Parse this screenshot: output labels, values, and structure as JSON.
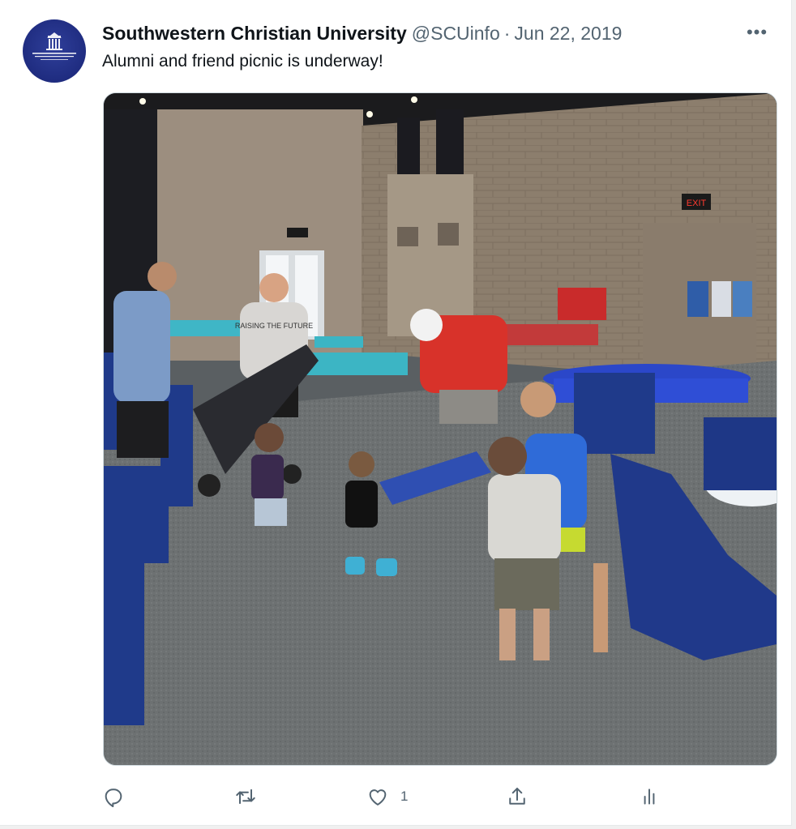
{
  "tweet": {
    "author_name": "Southwestern Christian University",
    "handle": "@SCUinfo",
    "separator": "·",
    "date": "Jun 22, 2019",
    "text": "Alumni and friend picnic is underway!",
    "more_label": "•••",
    "avatar_icon": "university-logo-icon",
    "media": {
      "shirt_text": "RAISING THE FUTURE",
      "exit_sign_text": "EXIT"
    }
  },
  "actions": {
    "reply_count": "",
    "retweet_count": "",
    "like_count": "1",
    "icons": [
      "reply-icon",
      "retweet-icon",
      "like-icon",
      "share-icon",
      "analytics-icon"
    ]
  },
  "colors": {
    "text_primary": "#0f1419",
    "text_secondary": "#536471",
    "avatar_bg": "#1f2c80",
    "border": "#cfd9de"
  }
}
